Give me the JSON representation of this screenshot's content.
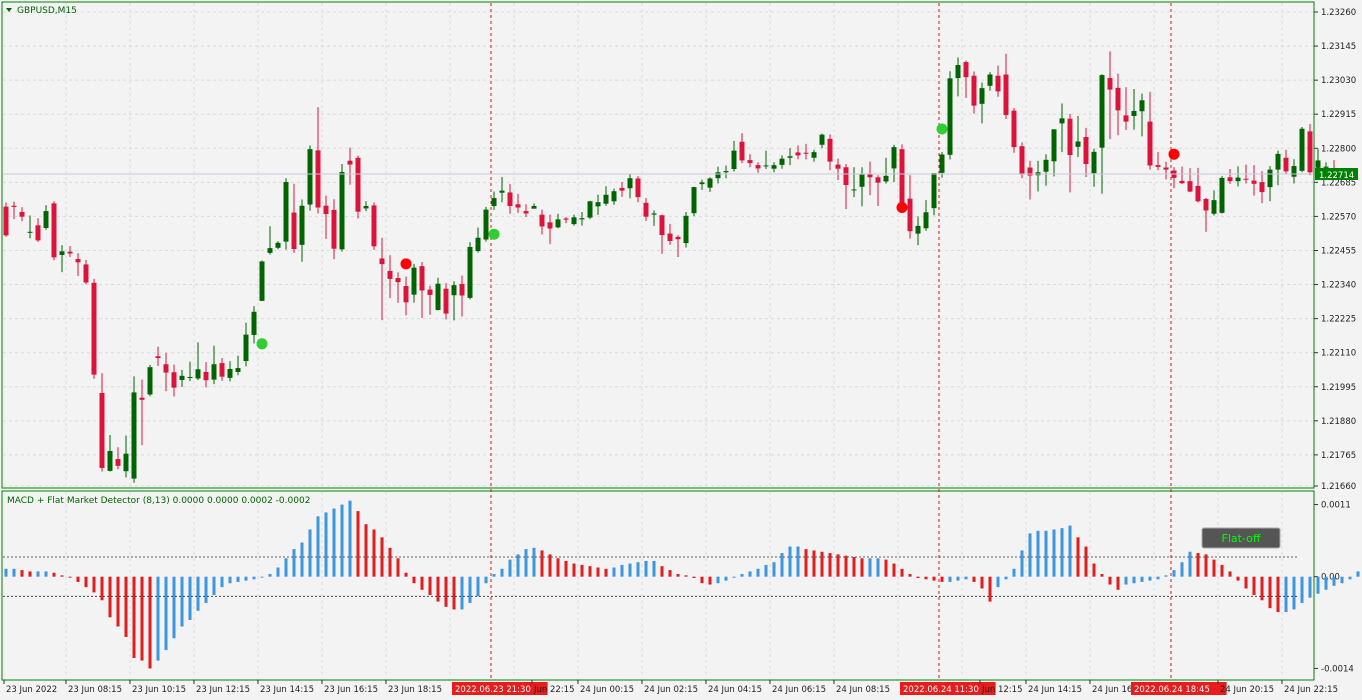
{
  "main_panel": {
    "symbol_label": "GBPUSD,M15",
    "price_axis": [
      "1.23260",
      "1.23145",
      "1.23030",
      "1.22915",
      "1.22800",
      "1.22685",
      "1.22570",
      "1.22455",
      "1.22340",
      "1.22225",
      "1.22110",
      "1.21995",
      "1.21880",
      "1.21765",
      "1.21660"
    ],
    "current_price": "1.22714",
    "ylim": [
      1.2166,
      1.2326
    ]
  },
  "indicator_panel": {
    "label": "MACD + Flat Market Detector (8,13) 0.0000 0.0000 0.0002 -0.0002",
    "axis": [
      "0.0011",
      "0.00",
      "-0.0014"
    ],
    "button_label": "Flat-off"
  },
  "time_axis": [
    "23 Jun 2022",
    "23 Jun 08:15",
    "23 Jun 10:15",
    "23 Jun 12:15",
    "23 Jun 14:15",
    "23 Jun 16:15",
    "23 Jun 18:15",
    "2022.06.23 21:30",
    "Jun 22:15",
    "24 Jun 00:15",
    "24 Jun 02:15",
    "24 Jun 04:15",
    "24 Jun 06:15",
    "24 Jun 08:15",
    "2022.06.24 11:30",
    "Jun 12:15",
    "24 Jun 14:15",
    "24 Jun 16",
    "2022.06.24 18:45",
    "24 Jun 20:15",
    "24 Jun 22:15"
  ],
  "colors": {
    "bull": "#006400",
    "bear": "#dc143c",
    "hist_up": "#3c96e6",
    "hist_down": "#e81c1c",
    "buy_dot": "#32cd32",
    "sell_dot": "#ff0000",
    "grid": "#dcdcdc",
    "vline": "#dc1414",
    "frame": "#008000",
    "button_bg": "#555555",
    "button_text": "#00ff00"
  },
  "chart_data": {
    "type": "candlestick",
    "candles_ohlc": [
      [
        1.22603,
        1.22617,
        1.22501,
        1.22506
      ],
      [
        1.22606,
        1.2262,
        1.22561,
        1.22602
      ],
      [
        1.22585,
        1.22601,
        1.22554,
        1.22569
      ],
      [
        1.22518,
        1.22573,
        1.22496,
        1.22518
      ],
      [
        1.2254,
        1.22564,
        1.22484,
        1.22489
      ],
      [
        1.22531,
        1.22608,
        1.22525,
        1.22588
      ],
      [
        1.22614,
        1.22621,
        1.22422,
        1.22432
      ],
      [
        1.2244,
        1.22473,
        1.22382,
        1.22452
      ],
      [
        1.22451,
        1.2247,
        1.22433,
        1.22445
      ],
      [
        1.22426,
        1.22446,
        1.22369,
        1.22415
      ],
      [
        1.22408,
        1.22423,
        1.22341,
        1.22347
      ],
      [
        1.22346,
        1.22359,
        1.22022,
        1.22036
      ],
      [
        1.21974,
        1.22041,
        1.21709,
        1.21721
      ],
      [
        1.21711,
        1.21832,
        1.21709,
        1.21778
      ],
      [
        1.21751,
        1.21791,
        1.21716,
        1.21728
      ],
      [
        1.2171,
        1.2183,
        1.21689,
        1.21769
      ],
      [
        1.21685,
        1.2203,
        1.21671,
        1.21976
      ],
      [
        1.21958,
        1.22019,
        1.21798,
        1.21951
      ],
      [
        1.21969,
        1.22069,
        1.21963,
        1.22061
      ],
      [
        1.22098,
        1.2213,
        1.22065,
        1.22092
      ],
      [
        1.22071,
        1.2211,
        1.2198,
        1.22043
      ],
      [
        1.22044,
        1.2207,
        1.21962,
        1.21992
      ],
      [
        1.22018,
        1.22052,
        1.21994,
        1.22032
      ],
      [
        1.22025,
        1.2208,
        1.22014,
        1.22028
      ],
      [
        1.22023,
        1.22145,
        1.22018,
        1.22054
      ],
      [
        1.22045,
        1.22078,
        1.21993,
        1.22017
      ],
      [
        1.22019,
        1.22134,
        1.22004,
        1.22071
      ],
      [
        1.22075,
        1.22092,
        1.22015,
        1.22029
      ],
      [
        1.22025,
        1.22081,
        1.22013,
        1.22055
      ],
      [
        1.22045,
        1.221,
        1.22034,
        1.22058
      ],
      [
        1.22082,
        1.22211,
        1.22064,
        1.22171
      ],
      [
        1.2217,
        1.22267,
        1.22141,
        1.22248
      ],
      [
        1.22285,
        1.22421,
        1.22284,
        1.22418
      ],
      [
        1.22447,
        1.22537,
        1.22441,
        1.22463
      ],
      [
        1.22464,
        1.22486,
        1.22459,
        1.22481
      ],
      [
        1.22485,
        1.22699,
        1.22458,
        1.22686
      ],
      [
        1.22583,
        1.2268,
        1.22447,
        1.2246
      ],
      [
        1.22474,
        1.22627,
        1.22417,
        1.22606
      ],
      [
        1.2261,
        1.2281,
        1.22589,
        1.22797
      ],
      [
        1.22793,
        1.22939,
        1.2258,
        1.226
      ],
      [
        1.22606,
        1.2264,
        1.22494,
        1.22578
      ],
      [
        1.22592,
        1.22628,
        1.22426,
        1.22461
      ],
      [
        1.22459,
        1.22747,
        1.22451,
        1.2272
      ],
      [
        1.22758,
        1.22802,
        1.22677,
        1.22745
      ],
      [
        1.22768,
        1.22775,
        1.22563,
        1.22586
      ],
      [
        1.22597,
        1.22621,
        1.22588,
        1.22605
      ],
      [
        1.22607,
        1.22617,
        1.22457,
        1.22469
      ],
      [
        1.22428,
        1.22498,
        1.2222,
        1.22409
      ],
      [
        1.22386,
        1.22439,
        1.22294,
        1.22359
      ],
      [
        1.22362,
        1.22381,
        1.22278,
        1.22348
      ],
      [
        1.22335,
        1.22367,
        1.22236,
        1.2228
      ],
      [
        1.22306,
        1.2241,
        1.22279,
        1.22397
      ],
      [
        1.22402,
        1.22416,
        1.22227,
        1.2232
      ],
      [
        1.22323,
        1.22336,
        1.22238,
        1.22305
      ],
      [
        1.22254,
        1.22363,
        1.22253,
        1.22343
      ],
      [
        1.22326,
        1.22345,
        1.22222,
        1.22242
      ],
      [
        1.22304,
        1.22351,
        1.22219,
        1.22338
      ],
      [
        1.22342,
        1.2237,
        1.22232,
        1.22303
      ],
      [
        1.22295,
        1.22483,
        1.2229,
        1.22467
      ],
      [
        1.22453,
        1.22532,
        1.22448,
        1.22498
      ],
      [
        1.22492,
        1.22602,
        1.22485,
        1.22593
      ],
      [
        1.22605,
        1.22654,
        1.22592,
        1.22632
      ],
      [
        1.2265,
        1.22703,
        1.22618,
        1.22657
      ],
      [
        1.22651,
        1.22679,
        1.22579,
        1.22605
      ],
      [
        1.22611,
        1.22646,
        1.22582,
        1.226
      ],
      [
        1.22588,
        1.22611,
        1.22568,
        1.2258
      ],
      [
        1.22596,
        1.22614,
        1.22597,
        1.22605
      ],
      [
        1.22576,
        1.22593,
        1.22509,
        1.22536
      ],
      [
        1.2255,
        1.22576,
        1.22476,
        1.22529
      ],
      [
        1.22533,
        1.22579,
        1.2253,
        1.2256
      ],
      [
        1.22563,
        1.22568,
        1.22547,
        1.22559
      ],
      [
        1.22544,
        1.22576,
        1.22539,
        1.22567
      ],
      [
        1.2256,
        1.22585,
        1.22539,
        1.22564
      ],
      [
        1.22566,
        1.22623,
        1.22561,
        1.22621
      ],
      [
        1.22604,
        1.22643,
        1.22575,
        1.22618
      ],
      [
        1.22613,
        1.22672,
        1.22606,
        1.22643
      ],
      [
        1.22621,
        1.22664,
        1.22609,
        1.22655
      ],
      [
        1.22666,
        1.22686,
        1.22636,
        1.22657
      ],
      [
        1.22665,
        1.22715,
        1.22631,
        1.22699
      ],
      [
        1.22698,
        1.22706,
        1.22618,
        1.22635
      ],
      [
        1.22616,
        1.22632,
        1.22555,
        1.22569
      ],
      [
        1.22576,
        1.2259,
        1.22538,
        1.2258
      ],
      [
        1.22574,
        1.22576,
        1.22444,
        1.22507
      ],
      [
        1.22512,
        1.22545,
        1.22474,
        1.22487
      ],
      [
        1.22501,
        1.22506,
        1.22433,
        1.22493
      ],
      [
        1.2248,
        1.22585,
        1.22465,
        1.22572
      ],
      [
        1.22581,
        1.2267,
        1.22571,
        1.22669
      ],
      [
        1.22679,
        1.22694,
        1.22659,
        1.22685
      ],
      [
        1.22667,
        1.22702,
        1.22653,
        1.22698
      ],
      [
        1.22699,
        1.22738,
        1.22681,
        1.22719
      ],
      [
        1.22719,
        1.22742,
        1.22699,
        1.22723
      ],
      [
        1.2273,
        1.22825,
        1.22721,
        1.22792
      ],
      [
        1.22822,
        1.22851,
        1.2275,
        1.22759
      ],
      [
        1.2276,
        1.2278,
        1.22736,
        1.2275
      ],
      [
        1.22743,
        1.22753,
        1.22718,
        1.22732
      ],
      [
        1.22742,
        1.22792,
        1.2273,
        1.22742
      ],
      [
        1.22731,
        1.22753,
        1.22719,
        1.22743
      ],
      [
        1.22744,
        1.22776,
        1.22731,
        1.22765
      ],
      [
        1.22768,
        1.228,
        1.22743,
        1.22773
      ],
      [
        1.22786,
        1.2281,
        1.22763,
        1.22776
      ],
      [
        1.22785,
        1.22815,
        1.22762,
        1.22782
      ],
      [
        1.22768,
        1.22795,
        1.22755,
        1.22787
      ],
      [
        1.22812,
        1.2285,
        1.228,
        1.22846
      ],
      [
        1.22832,
        1.22847,
        1.22726,
        1.22755
      ],
      [
        1.22745,
        1.22765,
        1.22693,
        1.22731
      ],
      [
        1.22736,
        1.22747,
        1.22595,
        1.22676
      ],
      [
        1.2266,
        1.22736,
        1.22635,
        1.22661
      ],
      [
        1.2267,
        1.22736,
        1.22604,
        1.22711
      ],
      [
        1.22714,
        1.22755,
        1.22642,
        1.22702
      ],
      [
        1.22702,
        1.22709,
        1.22605,
        1.22684
      ],
      [
        1.22688,
        1.22768,
        1.22681,
        1.22707
      ],
      [
        1.22732,
        1.22812,
        1.22686,
        1.22804
      ],
      [
        1.22797,
        1.22813,
        1.22585,
        1.226
      ],
      [
        1.2263,
        1.22709,
        1.22495,
        1.2252
      ],
      [
        1.22512,
        1.2257,
        1.22473,
        1.22538
      ],
      [
        1.2253,
        1.22625,
        1.22521,
        1.22584
      ],
      [
        1.22598,
        1.22716,
        1.22574,
        1.22716
      ],
      [
        1.22717,
        1.22787,
        1.22701,
        1.22779
      ],
      [
        1.22778,
        1.2306,
        1.22762,
        1.23036
      ],
      [
        1.23037,
        1.23107,
        1.22975,
        1.23081
      ],
      [
        1.23091,
        1.23096,
        1.2297,
        1.2304
      ],
      [
        1.23045,
        1.23059,
        1.22917,
        1.22944
      ],
      [
        1.2295,
        1.23022,
        1.22884,
        1.23003
      ],
      [
        1.23011,
        1.23057,
        1.22994,
        1.23049
      ],
      [
        1.23045,
        1.23079,
        1.22974,
        1.22992
      ],
      [
        1.23049,
        1.23119,
        1.22899,
        1.22912
      ],
      [
        1.22927,
        1.22936,
        1.22785,
        1.22804
      ],
      [
        1.22807,
        1.2282,
        1.22699,
        1.22711
      ],
      [
        1.22735,
        1.22758,
        1.22627,
        1.22708
      ],
      [
        1.22709,
        1.22758,
        1.22654,
        1.22719
      ],
      [
        1.22721,
        1.2278,
        1.22674,
        1.22761
      ],
      [
        1.22756,
        1.2286,
        1.22705,
        1.22864
      ],
      [
        1.22884,
        1.22951,
        1.22787,
        1.22901
      ],
      [
        1.229,
        1.22916,
        1.22651,
        1.22777
      ],
      [
        1.22805,
        1.22909,
        1.2277,
        1.22823
      ],
      [
        1.22838,
        1.22869,
        1.22703,
        1.22747
      ],
      [
        1.22716,
        1.22799,
        1.2267,
        1.22788
      ],
      [
        1.22802,
        1.2305,
        1.22647,
        1.23047
      ],
      [
        1.23037,
        1.23127,
        1.22831,
        1.22998
      ],
      [
        1.23004,
        1.23052,
        1.22844,
        1.22928
      ],
      [
        1.22911,
        1.23006,
        1.22862,
        1.2289
      ],
      [
        1.22909,
        1.23,
        1.22863,
        1.22926
      ],
      [
        1.22925,
        1.22985,
        1.2284,
        1.22962
      ],
      [
        1.2289,
        1.22991,
        1.22728,
        1.22742
      ],
      [
        1.22743,
        1.22787,
        1.22726,
        1.22737
      ],
      [
        1.22735,
        1.22754,
        1.22695,
        1.22728
      ],
      [
        1.22725,
        1.22736,
        1.22665,
        1.227
      ],
      [
        1.2269,
        1.22738,
        1.2268,
        1.22682
      ],
      [
        1.22689,
        1.22733,
        1.22652,
        1.22654
      ],
      [
        1.22673,
        1.22734,
        1.22617,
        1.22621
      ],
      [
        1.22629,
        1.22632,
        1.22518,
        1.2259
      ],
      [
        1.22579,
        1.22658,
        1.22573,
        1.22625
      ],
      [
        1.22582,
        1.22706,
        1.2258,
        1.227
      ],
      [
        1.22702,
        1.2273,
        1.2268,
        1.22689
      ],
      [
        1.22689,
        1.22739,
        1.22671,
        1.22701
      ],
      [
        1.22697,
        1.22745,
        1.22681,
        1.22694
      ],
      [
        1.22691,
        1.22743,
        1.2264,
        1.2268
      ],
      [
        1.22686,
        1.22723,
        1.22615,
        1.22652
      ],
      [
        1.22669,
        1.2274,
        1.22621,
        1.22728
      ],
      [
        1.22728,
        1.22792,
        1.22675,
        1.22781
      ],
      [
        1.22768,
        1.22795,
        1.22712,
        1.22722
      ],
      [
        1.22704,
        1.22763,
        1.22681,
        1.2274
      ],
      [
        1.22724,
        1.22872,
        1.22719,
        1.22866
      ],
      [
        1.22857,
        1.22882,
        1.22709,
        1.22719
      ],
      [
        1.22734,
        1.22799,
        1.22724,
        1.22759
      ],
      [
        1.22734,
        1.22753,
        1.22708,
        1.22738
      ],
      [
        1.22719,
        1.2276,
        1.22702,
        1.22714
      ]
    ],
    "buy_signals": [
      {
        "candle": 32,
        "price": 1.2214
      },
      {
        "candle": 61,
        "price": 1.2251
      },
      {
        "candle": 117,
        "price": 1.22865
      }
    ],
    "sell_signals": [
      {
        "candle": 50,
        "price": 1.2241
      },
      {
        "candle": 112,
        "price": 1.226
      },
      {
        "candle": 146,
        "price": 1.2278
      }
    ],
    "vertical_markers": [
      "2022.06.23 21:30",
      "2022.06.24 11:30",
      "2022.06.24 18:45"
    ],
    "macd_histogram": [
      0.00012,
      0.00012,
      0.0001,
      8e-05,
      8e-05,
      8e-05,
      6e-05,
      2e-05,
      0.0,
      -8e-05,
      -0.00016,
      -0.00024,
      -0.00036,
      -0.00062,
      -0.00076,
      -0.00092,
      -0.00124,
      -0.00128,
      -0.0014,
      -0.00128,
      -0.00112,
      -0.00094,
      -0.00076,
      -0.00066,
      -0.00052,
      -0.0004,
      -0.00028,
      -0.00016,
      -0.0001,
      -8e-05,
      -6e-05,
      -4e-05,
      0.0,
      4e-05,
      0.00014,
      0.00028,
      0.00042,
      0.00052,
      0.00072,
      0.00092,
      0.00098,
      0.00104,
      0.0011,
      0.00116,
      0.001,
      0.0008,
      0.00072,
      0.0006,
      0.00044,
      0.00028,
      6e-05,
      -0.0001,
      -0.0002,
      -0.00028,
      -0.00038,
      -0.00046,
      -0.0005,
      -0.0005,
      -0.0004,
      -0.0003,
      -0.0001,
      4e-05,
      0.00012,
      0.00026,
      0.00034,
      0.00042,
      0.00044,
      0.0004,
      0.00034,
      0.00028,
      0.00024,
      0.0002,
      0.00018,
      0.00016,
      0.00014,
      0.00012,
      0.00014,
      0.00018,
      0.0002,
      0.00022,
      0.00024,
      0.00024,
      0.00016,
      0.0001,
      4e-05,
      2e-05,
      -2e-05,
      -0.0001,
      -0.00012,
      -0.0001,
      -6e-05,
      0.0,
      4e-05,
      8e-05,
      0.00012,
      0.00018,
      0.00022,
      0.00036,
      0.00046,
      0.00046,
      0.00042,
      0.0004,
      0.00038,
      0.00036,
      0.00034,
      0.00032,
      0.0003,
      0.00028,
      0.00028,
      0.00028,
      0.00026,
      0.0002,
      0.00012,
      4e-05,
      -2e-05,
      -4e-05,
      -6e-05,
      -8e-05,
      -8e-05,
      -6e-05,
      -4e-05,
      -8e-05,
      -0.00018,
      -0.00038,
      -0.00016,
      -4e-05,
      0.00012,
      0.0004,
      0.00066,
      0.0007,
      0.0007,
      0.00072,
      0.00074,
      0.00078,
      0.0006,
      0.00046,
      0.0002,
      4e-05,
      -0.00012,
      -0.0002,
      -0.00012,
      -0.0001,
      -8e-05,
      -6e-05,
      -4e-05,
      2e-05,
      0.0001,
      0.00022,
      0.00038,
      0.00036,
      0.00034,
      0.00026,
      0.00018,
      8e-05,
      -6e-05,
      -0.00018,
      -0.00028,
      -0.00036,
      -0.00048,
      -0.00054,
      -0.00054,
      -0.0005,
      -0.0004,
      -0.00032,
      -0.00026,
      -0.0002,
      -0.00014,
      -0.0001,
      -4e-05,
      8e-05,
      0.0001,
      0.0001,
      4e-05
    ],
    "macd_levels": [
      0.0003,
      -0.0003
    ],
    "macd_ylim": [
      -0.0015,
      0.0012
    ]
  }
}
